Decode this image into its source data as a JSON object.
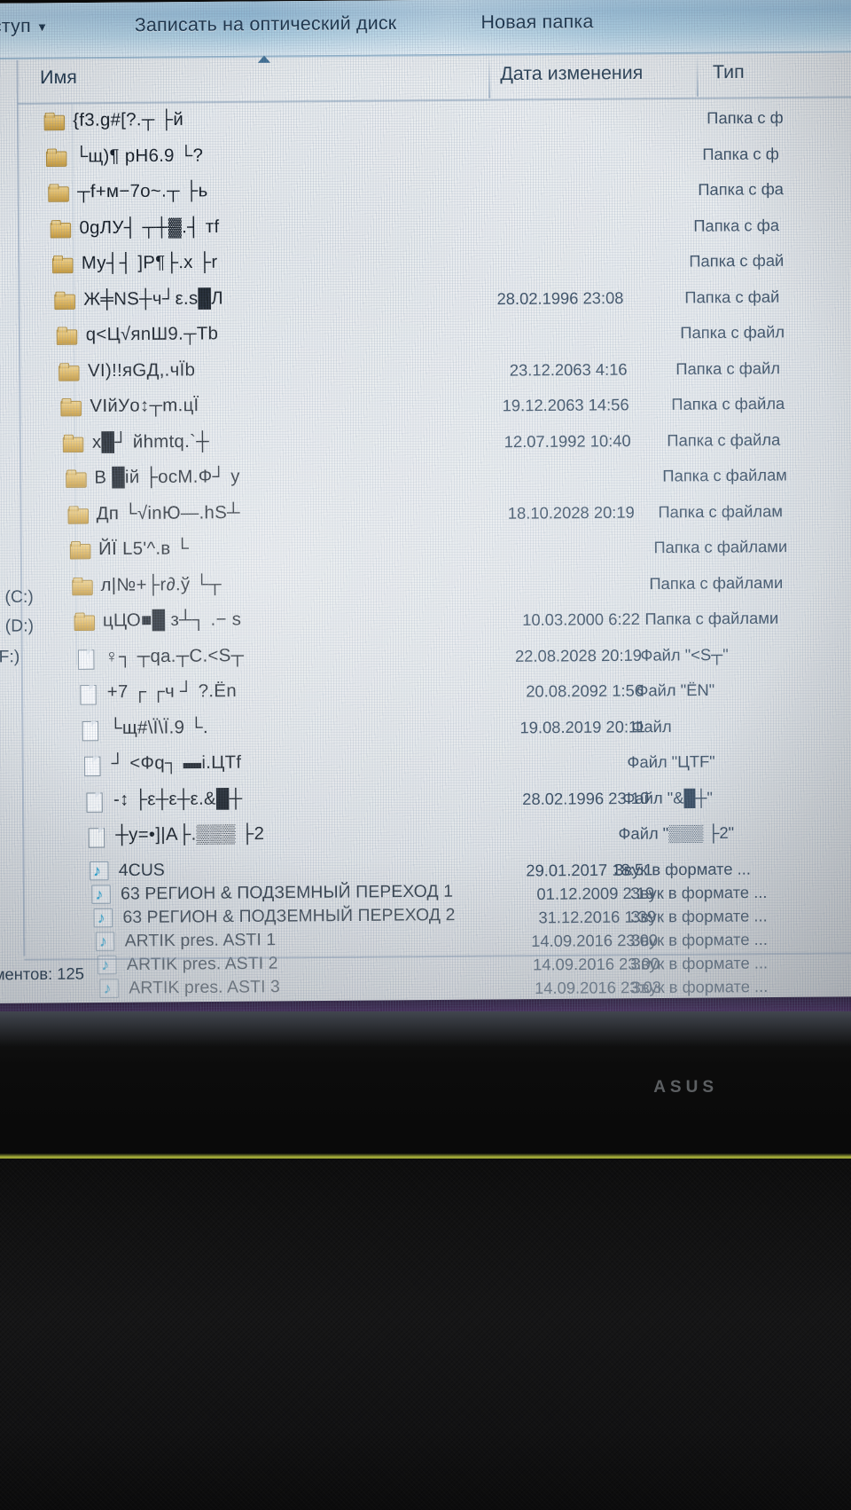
{
  "window": {
    "toolbar": {
      "share_label": "доступ",
      "share_caret": "▼",
      "burn_label": "Записать на оптический диск",
      "new_folder_label": "Новая папка"
    },
    "columns": {
      "name": "Имя",
      "date_modified": "Дата изменения",
      "type": "Тип"
    },
    "sidebar": [
      {
        "label": "к (C:)"
      },
      {
        "label": "к (D:)"
      },
      {
        "label": "(F:)"
      }
    ],
    "status": "ментов: 125"
  },
  "files": [
    {
      "name": "{f3.g#[?.┬ ├й",
      "icon": "folder-icon",
      "date": "",
      "type": "Папка с ф"
    },
    {
      "name": "└щ)¶ pH6.9 └?",
      "icon": "folder-icon",
      "date": "",
      "type": "Папка с ф"
    },
    {
      "name": "┬f+м−7o~.┬ ├ь",
      "icon": "folder-icon",
      "date": "",
      "type": "Папка с фа"
    },
    {
      "name": "0gЛУ┤ ┬┼▓.┤ тf",
      "icon": "folder-icon",
      "date": "",
      "type": "Папка с фа"
    },
    {
      "name": "Му┤┤ ]Р¶├.x ├r",
      "icon": "folder-icon",
      "date": "",
      "type": "Папка с фай"
    },
    {
      "name": "Ж╪NS┼ч┘ε.s█Л",
      "icon": "folder-icon",
      "date": "28.02.1996 23:08",
      "type": "Папка с фай"
    },
    {
      "name": "q<Ц√яnШ9.┬Tb",
      "icon": "folder-icon",
      "date": "",
      "type": "Папка с файл"
    },
    {
      "name": "VI)!!яGД,.чÏb",
      "icon": "folder-icon",
      "date": "23.12.2063 4:16",
      "type": "Папка с файл"
    },
    {
      "name": "VIйУo↕┬m.цЇ",
      "icon": "folder-icon",
      "date": "19.12.2063 14:56",
      "type": "Папка с файла"
    },
    {
      "name": "x█┘ йhmtq.`┼",
      "icon": "folder-icon",
      "date": "12.07.1992 10:40",
      "type": "Папка с файла"
    },
    {
      "name": "В █ій ├ocМ.Ф┘ у",
      "icon": "folder-icon",
      "date": "",
      "type": "Папка с файлам"
    },
    {
      "name": "Дп └√inЮ—.hS┴",
      "icon": "folder-icon",
      "date": "18.10.2028 20:19",
      "type": "Папка с файлам"
    },
    {
      "name": "ЙÏ  L5'^.в └",
      "icon": "folder-icon",
      "date": "",
      "type": "Папка с файлами"
    },
    {
      "name": "л|№+├r∂.ў └┬",
      "icon": "folder-icon",
      "date": "",
      "type": "Папка с файлами"
    },
    {
      "name": "цЦО■█ з┴┐ .−  s",
      "icon": "folder-icon",
      "date": "10.03.2000 6:22",
      "type": "Папка с файлами"
    },
    {
      "name": "♀┐ ┬qa.┬C.<S┬",
      "icon": "doc-icon",
      "date": "22.08.2028 20:19",
      "type": "Файл \"<S┬\""
    },
    {
      "name": "+7 ┌ ┌ч ┘ ?.Ёn",
      "icon": "doc-icon",
      "date": "20.08.2092 1:56",
      "type": "Файл \"ЁN\""
    },
    {
      "name": "└щ#\\Ï\\Ï.9 └.",
      "icon": "doc-icon",
      "date": "19.08.2019 20:11",
      "type": "Файл"
    },
    {
      "name": "┘ <Фq┐ ▬i.ЦTf",
      "icon": "doc-icon",
      "date": "",
      "type": "Файл \"ЦTF\""
    },
    {
      "name": "-↕ ├ε┼ε┼ε.&█┼",
      "icon": "doc-icon",
      "date": "28.02.1996 23:10",
      "type": "Файл \"&█┼\""
    },
    {
      "name": "┼y=•]|A├.▒▒▒ ├2",
      "icon": "doc-icon",
      "date": "",
      "type": "Файл \"▒▒▒ ├2\""
    },
    {
      "name": "4CUS",
      "icon": "music-icon",
      "date": "29.01.2017 18:51",
      "type": "Звук в формате ..."
    },
    {
      "name": "63 РЕГИОН & ПОДЗЕМНЫЙ ПЕРЕХОД 1",
      "icon": "music-icon",
      "date": "01.12.2009 2:19",
      "type": "Звук в формате ..."
    },
    {
      "name": "63 РЕГИОН & ПОДЗЕМНЫЙ ПЕРЕХОД 2",
      "icon": "music-icon",
      "date": "31.12.2016 1:39",
      "type": "Звук в формате ..."
    },
    {
      "name": "ARTIK pres. ASTI 1",
      "icon": "music-icon",
      "date": "14.09.2016 23:00",
      "type": "Звук в формате ..."
    },
    {
      "name": "ARTIK pres. ASTI 2",
      "icon": "music-icon",
      "date": "14.09.2016 23:00",
      "type": "Звук в формате ..."
    },
    {
      "name": "ARTIK pres. ASTI 3",
      "icon": "music-icon",
      "date": "14.09.2016 23:03",
      "type": "Звук в формате ..."
    }
  ],
  "laptop": {
    "brand": "ASUS"
  },
  "colors": {
    "toolbar": "#9ec3dc",
    "text": "#22384d",
    "folder": "#e3bb63",
    "music_note": "#2aa8d6"
  }
}
